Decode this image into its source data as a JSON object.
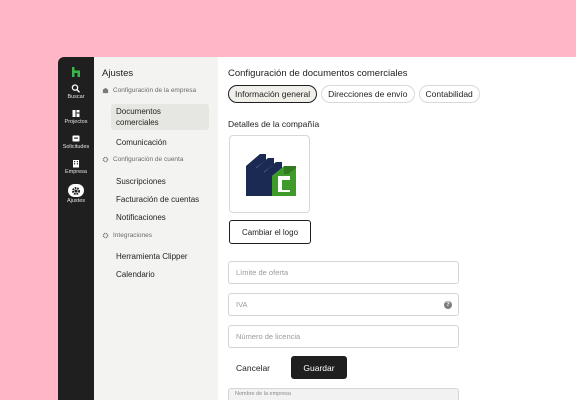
{
  "colors": {
    "background": "#ffb6c6",
    "rail": "#1f1f1f",
    "brand_green": "#3bb54a",
    "logo_navy": "#1b2a52",
    "logo_green": "#3e9b2a"
  },
  "rail": {
    "logo_icon": "houzz-h-icon",
    "items": [
      {
        "label": "Buscar",
        "icon": "search-icon"
      },
      {
        "label": "Projectos",
        "icon": "projects-icon"
      },
      {
        "label": "Solicitudes",
        "icon": "inbox-icon"
      },
      {
        "label": "Empresa",
        "icon": "building-icon"
      },
      {
        "label": "Ajustes",
        "icon": "gear-icon",
        "active": true
      }
    ]
  },
  "settings": {
    "title": "Ajustes",
    "groups": [
      {
        "label": "Configuración de la empresa",
        "icon": "building-icon",
        "items": [
          "Documentos comerciales",
          "Comunicación"
        ],
        "active_item": "Documentos comerciales"
      },
      {
        "label": "Configuración de cuenta",
        "icon": "gear-icon",
        "items": [
          "Suscripciones",
          "Facturación de cuentas",
          "Notificaciones"
        ]
      },
      {
        "label": "Integraciones",
        "icon": "plug-icon",
        "items": [
          "Herramienta Clipper",
          "Calendario"
        ]
      }
    ]
  },
  "main": {
    "title": "Configuración de documentos comerciales",
    "tabs": [
      "Información general",
      "Direcciones de envío",
      "Contabilidad"
    ],
    "active_tab": "Información general",
    "section_title": "Detalles de la compañía",
    "change_logo_label": "Cambiar el logo",
    "fields": {
      "offer_limit_placeholder": "Límite de oferta",
      "vat_placeholder": "IVA",
      "license_placeholder": "Número de licencia"
    },
    "cancel_label": "Cancelar",
    "save_label": "Guardar",
    "company_name_label": "Nombre de la empresa"
  }
}
